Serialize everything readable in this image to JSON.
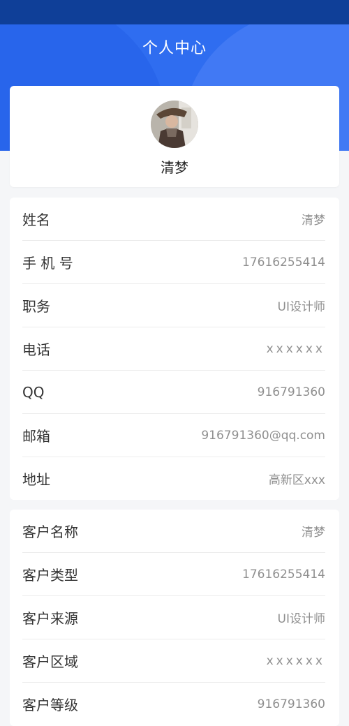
{
  "header": {
    "title": "个人中心"
  },
  "profile": {
    "name": "清梦"
  },
  "personal_info": [
    {
      "label": "姓名",
      "value": "清梦"
    },
    {
      "label": "手 机 号",
      "value": "17616255414"
    },
    {
      "label": "职务",
      "value": "UI设计师"
    },
    {
      "label": "电话",
      "value": "xxxxxx"
    },
    {
      "label": "QQ",
      "value": "916791360"
    },
    {
      "label": "邮箱",
      "value": "916791360@qq.com"
    },
    {
      "label": "地址",
      "value": "高新区xxx"
    }
  ],
  "customer_info": [
    {
      "label": "客户名称",
      "value": "清梦"
    },
    {
      "label": "客户类型",
      "value": "17616255414"
    },
    {
      "label": "客户来源",
      "value": "UI设计师"
    },
    {
      "label": "客户区域",
      "value": "xxxxxx"
    },
    {
      "label": "客户等级",
      "value": "916791360"
    }
  ],
  "colors": {
    "status_bar": "#0f3f98",
    "header": "#2f6df0",
    "background": "#f5f6f8"
  }
}
